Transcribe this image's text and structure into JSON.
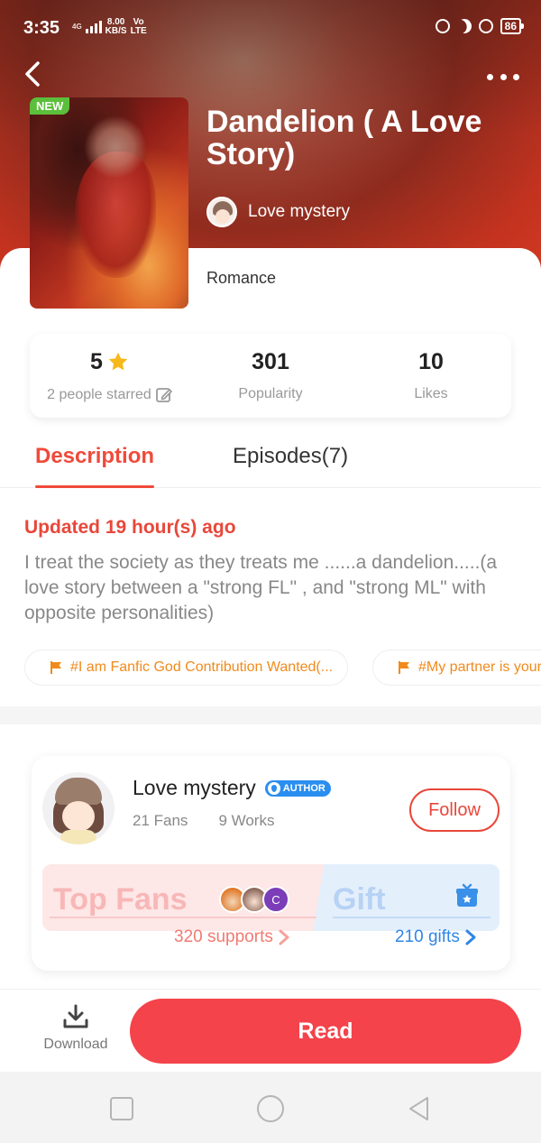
{
  "status_bar": {
    "time": "3:35",
    "network_label": "4G",
    "speed_value": "8.00",
    "speed_unit": "KB/S",
    "carrier_tag": "Vo",
    "lte": "LTE",
    "battery": "86"
  },
  "header": {
    "back_icon": "chevron-left-icon",
    "more_icon": "more-dots-icon"
  },
  "book": {
    "badge": "NEW",
    "title": "Dandelion ( A Love Story)",
    "author": "Love mystery",
    "genre": "Romance"
  },
  "stats": {
    "rating_value": "5",
    "rating_label": "2 people starred",
    "popularity_value": "301",
    "popularity_label": "Popularity",
    "likes_value": "10",
    "likes_label": "Likes"
  },
  "tabs": {
    "description": "Description",
    "episodes": "Episodes(7)"
  },
  "description": {
    "updated": "Updated 19 hour(s) ago",
    "text": "I treat the society as they treats me ......a dandelion.....(a love story between a \"strong FL\" , and \"strong ML\" with opposite personalities)",
    "tags": [
      "#I am Fanfic God Contribution Wanted(...",
      "#My partner is your"
    ]
  },
  "author_card": {
    "name": "Love mystery",
    "badge": "AUTHOR",
    "fans": "21 Fans",
    "works": "9 Works",
    "follow": "Follow",
    "top_fans_title": "Top Fans",
    "top_fans_third_initial": "C",
    "supports": "320 supports",
    "gift_title": "Gift",
    "gifts": "210 gifts"
  },
  "bottom_bar": {
    "download": "Download",
    "read": "Read"
  },
  "colors": {
    "accent": "#f04a3a",
    "read_button": "#f4434a",
    "tag_orange": "#f08a1c",
    "gift_blue": "#2e86e6",
    "badge_green": "#5bbf3b"
  }
}
